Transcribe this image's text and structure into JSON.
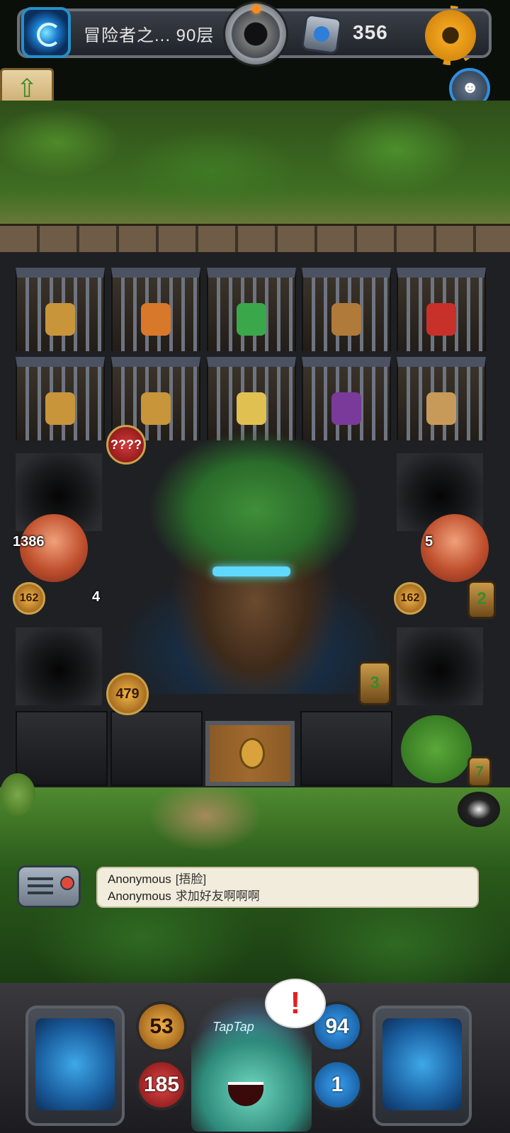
{
  "header": {
    "floor_title": "冒险者之... 90层",
    "coins": "356"
  },
  "board": {
    "unknown_damage": "????",
    "left_monster_hp": "1386",
    "left_monster_atk": "162",
    "left_monster_side": "4",
    "right_monster_hp": "5",
    "right_monster_atk": "162",
    "right_monster_side": "2",
    "boss_atk": "479",
    "boss_turns": "3",
    "tree_turns": "7"
  },
  "chat": {
    "lines": [
      {
        "user": "Anonymous",
        "text": "[捂脸]"
      },
      {
        "user": "Anonymous",
        "text": "求加好友啊啊啊"
      }
    ]
  },
  "player": {
    "attack": "53",
    "hp": "185",
    "defense": "94",
    "keys": "1",
    "alert_symbol": "!",
    "avatar_text": "TapTap"
  },
  "icons": {
    "portal": "portal-icon",
    "bomb": "bomb-icon",
    "gem": "gem-icon",
    "settings": "gear-icon",
    "up": "arrow-up-icon"
  }
}
